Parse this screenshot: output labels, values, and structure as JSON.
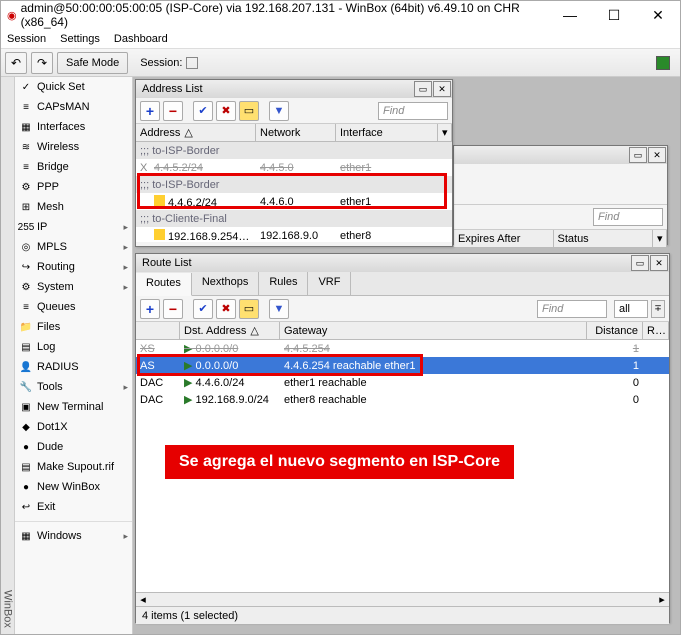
{
  "window": {
    "title": "admin@50:00:00:05:00:05 (ISP-Core) via 192.168.207.131 - WinBox (64bit) v6.49.10 on CHR (x86_64)"
  },
  "menubar": [
    "Session",
    "Settings",
    "Dashboard"
  ],
  "toolbar": {
    "safe": "Safe Mode",
    "session_label": "Session:"
  },
  "sidebar": [
    {
      "label": "Quick Set",
      "icon": "✓",
      "sub": false
    },
    {
      "label": "CAPsMAN",
      "icon": "≡",
      "sub": false
    },
    {
      "label": "Interfaces",
      "icon": "▦",
      "sub": false
    },
    {
      "label": "Wireless",
      "icon": "≋",
      "sub": false
    },
    {
      "label": "Bridge",
      "icon": "≡",
      "sub": false
    },
    {
      "label": "PPP",
      "icon": "⚙",
      "sub": false
    },
    {
      "label": "Mesh",
      "icon": "⊞",
      "sub": false
    },
    {
      "label": "IP",
      "icon": "255",
      "sub": true
    },
    {
      "label": "MPLS",
      "icon": "◎",
      "sub": true
    },
    {
      "label": "Routing",
      "icon": "↪",
      "sub": true
    },
    {
      "label": "System",
      "icon": "⚙",
      "sub": true
    },
    {
      "label": "Queues",
      "icon": "≡",
      "sub": false
    },
    {
      "label": "Files",
      "icon": "📁",
      "sub": false
    },
    {
      "label": "Log",
      "icon": "▤",
      "sub": false
    },
    {
      "label": "RADIUS",
      "icon": "👤",
      "sub": false
    },
    {
      "label": "Tools",
      "icon": "🔧",
      "sub": true
    },
    {
      "label": "New Terminal",
      "icon": "▣",
      "sub": false
    },
    {
      "label": "Dot1X",
      "icon": "◆",
      "sub": false
    },
    {
      "label": "Dude",
      "icon": "●",
      "sub": false
    },
    {
      "label": "Make Supout.rif",
      "icon": "▤",
      "sub": false
    },
    {
      "label": "New WinBox",
      "icon": "●",
      "sub": false
    },
    {
      "label": "Exit",
      "icon": "↩",
      "sub": false
    },
    {
      "label": "Windows",
      "icon": "▦",
      "sub": true,
      "sep": true
    }
  ],
  "addresslist": {
    "title": "Address List",
    "find": "Find",
    "cols": [
      "Address",
      "Network",
      "Interface"
    ],
    "rows": [
      {
        "group": ";;; to-ISP-Border"
      },
      {
        "flag": "X",
        "addr": "4.4.5.2/24",
        "net": "4.4.5.0",
        "if": "ether1",
        "struck": true
      },
      {
        "group": ";;; to-ISP-Border",
        "boxed": true
      },
      {
        "flag": "",
        "addr": "4.4.6.2/24",
        "net": "4.4.6.0",
        "if": "ether1",
        "icon": "yellow",
        "boxed": true
      },
      {
        "group": ";;; to-Cliente-Final"
      },
      {
        "flag": "",
        "addr": "192.168.9.254…",
        "net": "192.168.9.0",
        "if": "ether8",
        "icon": "yellow"
      }
    ]
  },
  "otherwin": {
    "find": "Find",
    "cols": [
      "Expires After",
      "Status"
    ]
  },
  "routelist": {
    "title": "Route List",
    "tabs": [
      "Routes",
      "Nexthops",
      "Rules",
      "VRF"
    ],
    "find": "Find",
    "all": "all",
    "cols": [
      "",
      "Dst. Address",
      "Gateway",
      "Distance",
      "R…"
    ],
    "rows": [
      {
        "f": "XS",
        "dst": "0.0.0.0/0",
        "gw": "4.4.5.254",
        "dist": "1",
        "r": "",
        "icon": "green",
        "struck": true
      },
      {
        "f": "AS",
        "dst": "0.0.0.0/0",
        "gw": "4.4.6.254 reachable ether1",
        "dist": "1",
        "r": "",
        "icon": "green",
        "sel": true
      },
      {
        "f": "DAC",
        "dst": "4.4.6.0/24",
        "gw": "ether1 reachable",
        "dist": "0",
        "r": "",
        "icon": "green"
      },
      {
        "f": "DAC",
        "dst": "192.168.9.0/24",
        "gw": "ether8 reachable",
        "dist": "0",
        "r": "",
        "icon": "green"
      }
    ],
    "status": "4 items (1 selected)"
  },
  "banner": "Se agrega el nuevo segmento en ISP-Core",
  "sidestrip": "WinBox"
}
